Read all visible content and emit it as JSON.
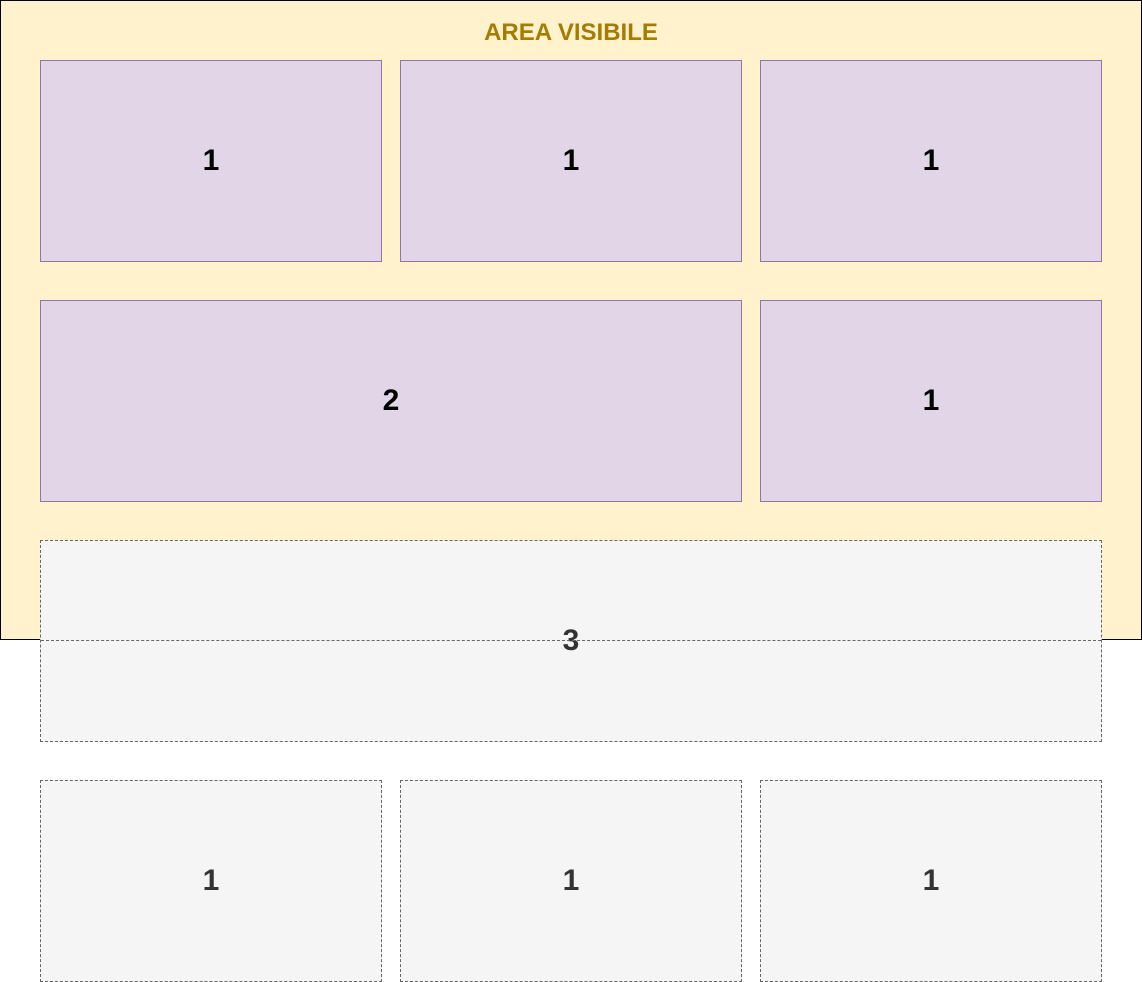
{
  "diagram": {
    "title": "AREA VISIBILE",
    "colors": {
      "title": "#a67c00",
      "visible_area_fill": "#fff2cc",
      "visible_box_fill": "#e1d5e7",
      "visible_box_stroke": "#9673a6",
      "hidden_box_fill": "#f5f5f5",
      "hidden_box_stroke": "#666666",
      "hidden_box_text": "#333333"
    },
    "boxes": [
      {
        "label": "1",
        "state": "visible"
      },
      {
        "label": "1",
        "state": "visible"
      },
      {
        "label": "1",
        "state": "visible"
      },
      {
        "label": "2",
        "state": "visible"
      },
      {
        "label": "1",
        "state": "visible"
      },
      {
        "label": "3",
        "state": "partially-visible"
      },
      {
        "label": "1",
        "state": "hidden"
      },
      {
        "label": "1",
        "state": "hidden"
      },
      {
        "label": "1",
        "state": "hidden"
      }
    ]
  }
}
